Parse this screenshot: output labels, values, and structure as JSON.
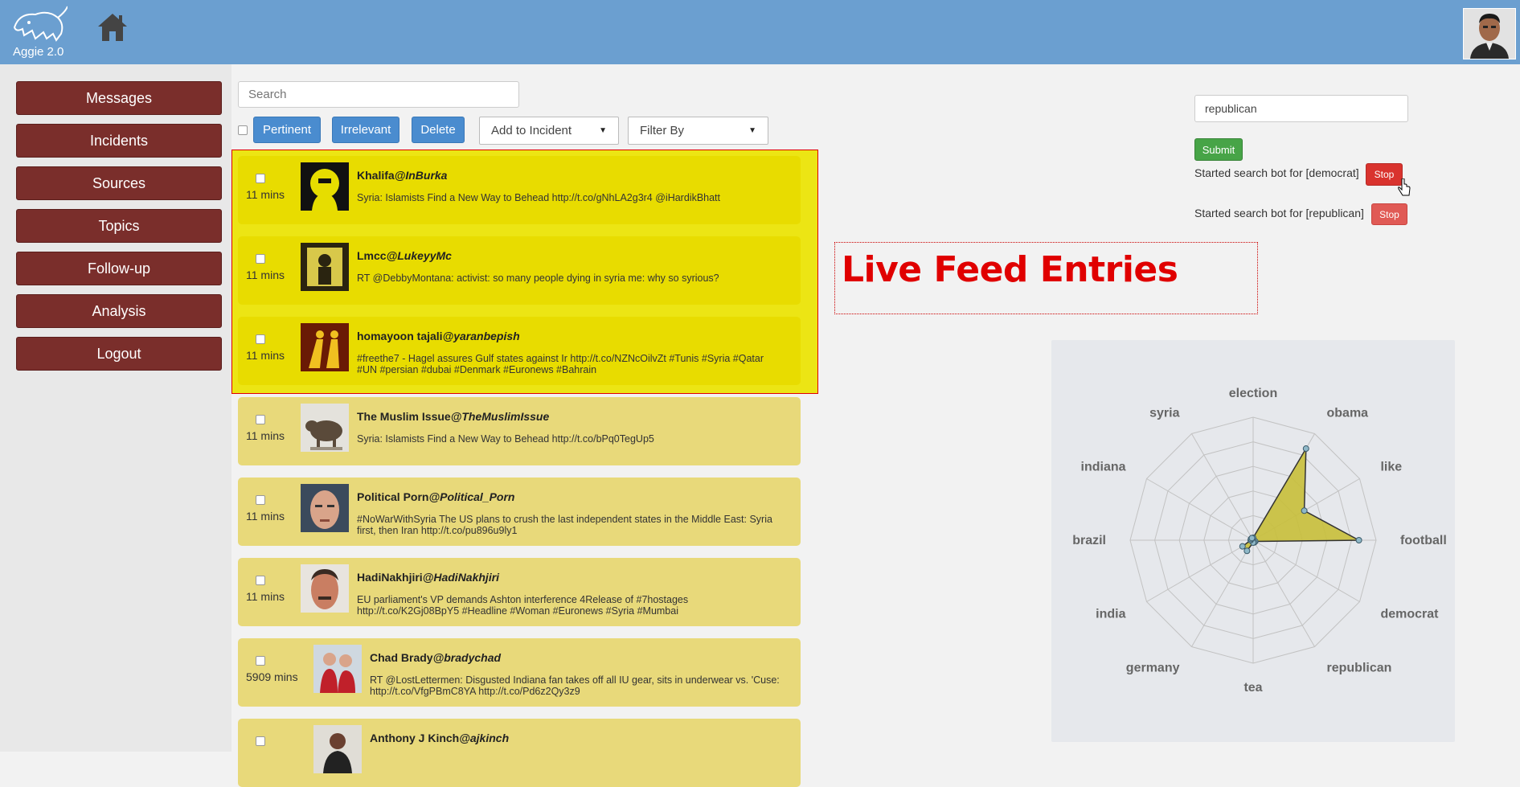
{
  "app": {
    "name": "Aggie 2.0"
  },
  "nav": {
    "items": [
      {
        "label": "Messages"
      },
      {
        "label": "Incidents"
      },
      {
        "label": "Sources"
      },
      {
        "label": "Topics"
      },
      {
        "label": "Follow-up"
      },
      {
        "label": "Analysis"
      },
      {
        "label": "Logout"
      }
    ]
  },
  "toolbar": {
    "search_placeholder": "Search",
    "pertinent_label": "Pertinent",
    "irrelevant_label": "Irrelevant",
    "delete_label": "Delete",
    "add_to_incident_label": "Add to Incident",
    "filter_by_label": "Filter By"
  },
  "feed": [
    {
      "time": "11 mins",
      "name": "Khalifa",
      "handle": "@InBurka",
      "text": "Syria: Islamists Find a New Way to Behead http://t.co/gNhLA2g3r4 @iHardikBhatt",
      "highlighted": true
    },
    {
      "time": "11 mins",
      "name": "Lmcc",
      "handle": "@LukeyyMc",
      "text": "RT @DebbyMontana: activist: so many people dying in syria me: why so syrious?",
      "highlighted": true
    },
    {
      "time": "11 mins",
      "name": "homayoon tajali",
      "handle": "@yaranbepish",
      "text": "#freethe7 - Hagel assures Gulf states against Ir http://t.co/NZNcOilvZt #Tunis #Syria #Qatar #UN #persian #dubai #Denmark #Euronews #Bahrain",
      "highlighted": true
    },
    {
      "time": "11 mins",
      "name": "The Muslim Issue",
      "handle": "@TheMuslimIssue",
      "text": "Syria: Islamists Find a New Way to Behead http://t.co/bPq0TegUp5",
      "highlighted": false
    },
    {
      "time": "11 mins",
      "name": "Political Porn",
      "handle": "@Political_Porn",
      "text": "#NoWarWithSyria The US plans to crush the last independent states in the Middle East: Syria first, then Iran http://t.co/pu896u9ly1",
      "highlighted": false
    },
    {
      "time": "11 mins",
      "name": "HadiNakhjiri",
      "handle": "@HadiNakhjiri",
      "text": "EU parliament's VP demands Ashton interference 4Release of #7hostages http://t.co/K2Gj08BpY5 #Headline #Woman #Euronews #Syria #Mumbai",
      "highlighted": false
    },
    {
      "time": "5909 mins",
      "name": "Chad Brady",
      "handle": "@bradychad",
      "text": "RT @LostLettermen: Disgusted Indiana fan takes off all IU gear, sits in underwear vs. 'Cuse: http://t.co/VfgPBmC8YA http://t.co/Pd6z2Qy3z9",
      "highlighted": false
    },
    {
      "time": "",
      "name": "Anthony J Kinch",
      "handle": "@ajkinch",
      "text": "",
      "highlighted": false
    }
  ],
  "annotation": {
    "label": "Live Feed Entries"
  },
  "bot": {
    "keyword_value": "republican",
    "submit_label": "Submit",
    "entries": [
      {
        "text": "Started search bot for [democrat]",
        "stop_label": "Stop"
      },
      {
        "text": "Started search bot for [republican]",
        "stop_label": "Stop"
      }
    ]
  },
  "colors": {
    "header": "#6b9fd0",
    "nav": "#7a2e2b",
    "highlight": "#e8dc00",
    "feed_item": "#e8d97a",
    "annotation": "#e00000"
  },
  "chart_data": {
    "type": "radar",
    "categories": [
      "election",
      "obama",
      "like",
      "football",
      "democrat",
      "republican",
      "tea",
      "germany",
      "india",
      "brazil",
      "indiana",
      "syria"
    ],
    "series": [
      {
        "values": [
          0.02,
          0.86,
          0.48,
          0.86,
          0.02,
          0.02,
          0.02,
          0.1,
          0.1,
          0.02,
          0.02,
          0.02
        ]
      }
    ],
    "rmax": 1,
    "rings": 5,
    "colors": {
      "fill": "#c8bf3a",
      "stroke": "#333333",
      "point": "#8fb8c8"
    }
  }
}
